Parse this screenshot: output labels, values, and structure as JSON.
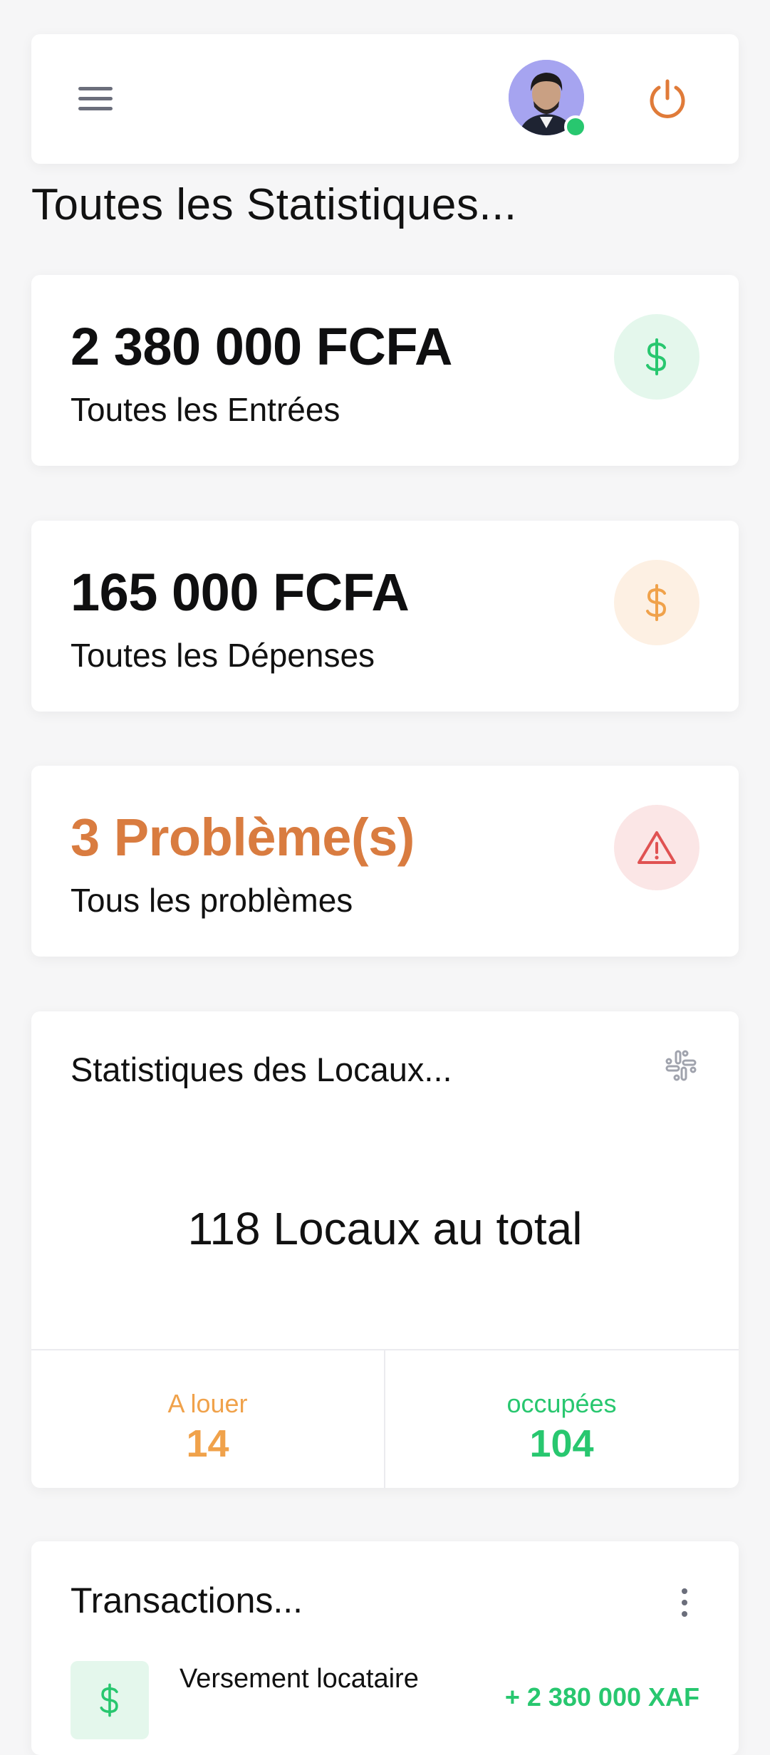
{
  "header": {
    "menu_icon": "hamburger-menu-icon",
    "avatar_alt": "user-avatar",
    "status_color": "#28c76f",
    "power_icon": "power-icon",
    "power_color": "#e07b39"
  },
  "page": {
    "title": "Toutes les Statistiques..."
  },
  "stats": [
    {
      "value": "2 380 000 FCFA",
      "label": "Toutes les Entrées",
      "icon": "dollar-icon",
      "icon_color": "#28c76f",
      "icon_bg": "#e4f7ec",
      "value_color": "#0f0f10"
    },
    {
      "value": "165 000 FCFA",
      "label": "Toutes les Dépenses",
      "icon": "dollar-icon",
      "icon_color": "#f0a24b",
      "icon_bg": "#fdf0e3",
      "value_color": "#0f0f10"
    },
    {
      "value": "3 Problème(s)",
      "label": "Tous les problèmes",
      "icon": "warning-triangle-icon",
      "icon_color": "#e05252",
      "icon_bg": "#fbe6e6",
      "value_color": "#d97c40"
    }
  ],
  "locaux": {
    "title": "Statistiques des Locaux...",
    "icon": "slack-hash-icon",
    "total": "118 Locaux au total",
    "a_louer_label": "A louer",
    "a_louer_value": "14",
    "a_louer_color": "#f0a24b",
    "occupees_label": "occupées",
    "occupees_value": "104",
    "occupees_color": "#28c76f"
  },
  "transactions": {
    "title": "Transactions...",
    "items": [
      {
        "description": "Versement locataire",
        "amount": "+ 2 380 000 XAF",
        "icon": "dollar-icon"
      }
    ]
  }
}
